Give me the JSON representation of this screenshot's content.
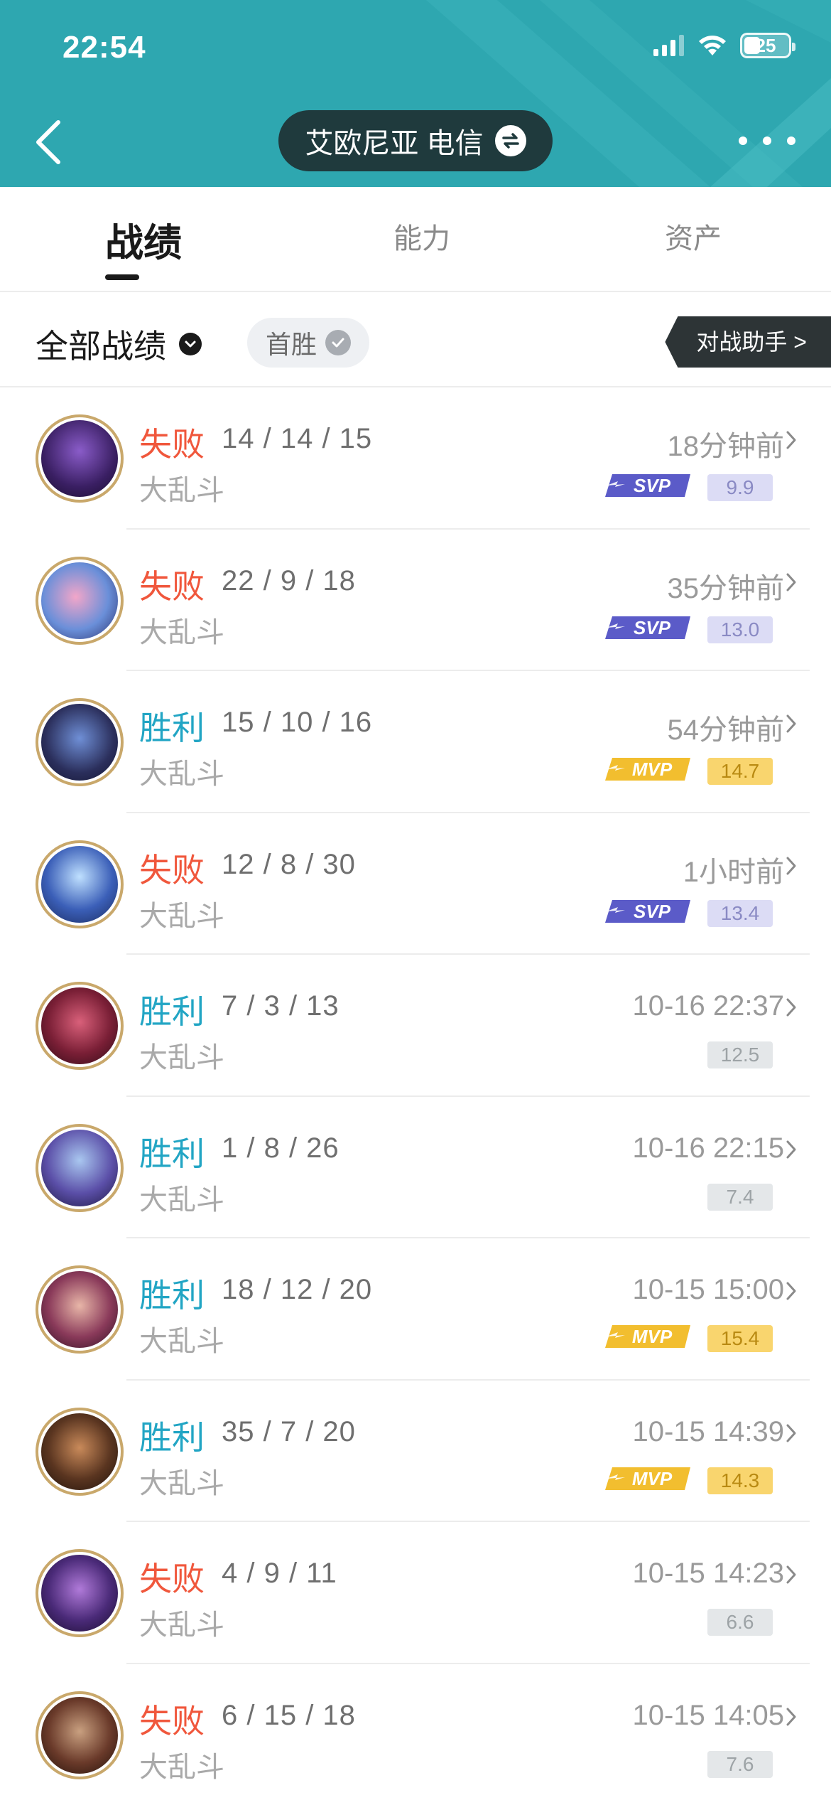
{
  "status_bar": {
    "time": "22:54",
    "battery": "25"
  },
  "header": {
    "server_name": "艾欧尼亚 电信"
  },
  "tabs": [
    {
      "label": "战绩"
    },
    {
      "label": "能力"
    },
    {
      "label": "资产"
    }
  ],
  "filter": {
    "all_label": "全部战绩",
    "first_win_label": "首胜",
    "assistant_label": "对战助手 >"
  },
  "medals": {
    "svp": "SVP",
    "mvp": "MVP"
  },
  "colors": {
    "header_bg": "#2ea7b0",
    "loss": "#f0573c",
    "win": "#22a5c4",
    "svp_badge": "#5b5bc8",
    "mvp_badge": "#f2be2f"
  },
  "matches": [
    {
      "result": "失败",
      "kda": "14 / 14 / 15",
      "mode": "大乱斗",
      "time": "18分钟前",
      "score": "9.9",
      "medal": "svp"
    },
    {
      "result": "失败",
      "kda": "22 / 9 / 18",
      "mode": "大乱斗",
      "time": "35分钟前",
      "score": "13.0",
      "medal": "svp"
    },
    {
      "result": "胜利",
      "kda": "15 / 10 / 16",
      "mode": "大乱斗",
      "time": "54分钟前",
      "score": "14.7",
      "medal": "mvp"
    },
    {
      "result": "失败",
      "kda": "12 / 8 / 30",
      "mode": "大乱斗",
      "time": "1小时前",
      "score": "13.4",
      "medal": "svp"
    },
    {
      "result": "胜利",
      "kda": "7 / 3 / 13",
      "mode": "大乱斗",
      "time": "10-16 22:37",
      "score": "12.5",
      "medal": "none"
    },
    {
      "result": "胜利",
      "kda": "1 / 8 / 26",
      "mode": "大乱斗",
      "time": "10-16 22:15",
      "score": "7.4",
      "medal": "none"
    },
    {
      "result": "胜利",
      "kda": "18 / 12 / 20",
      "mode": "大乱斗",
      "time": "10-15 15:00",
      "score": "15.4",
      "medal": "mvp"
    },
    {
      "result": "胜利",
      "kda": "35 / 7 / 20",
      "mode": "大乱斗",
      "time": "10-15 14:39",
      "score": "14.3",
      "medal": "mvp"
    },
    {
      "result": "失败",
      "kda": "4 / 9 / 11",
      "mode": "大乱斗",
      "time": "10-15 14:23",
      "score": "6.6",
      "medal": "none"
    },
    {
      "result": "失败",
      "kda": "6 / 15 / 18",
      "mode": "大乱斗",
      "time": "10-15 14:05",
      "score": "7.6",
      "medal": "none"
    }
  ]
}
